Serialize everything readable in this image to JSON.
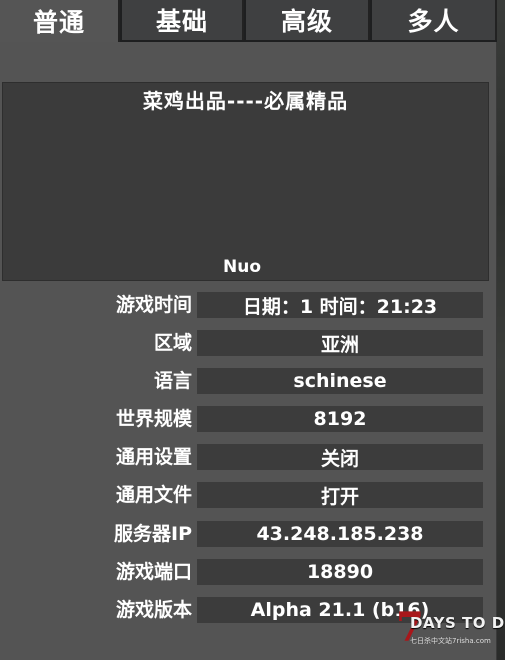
{
  "tabs": [
    {
      "label": "普通"
    },
    {
      "label": "基础"
    },
    {
      "label": "高级"
    },
    {
      "label": "多人"
    }
  ],
  "server": {
    "title": "菜鸡出品----必属精品",
    "owner": "Nuo"
  },
  "info_rows": [
    {
      "label": "游戏时间",
      "value": "日期：1 时间：21:23"
    },
    {
      "label": "区域",
      "value": "亚洲"
    },
    {
      "label": "语言",
      "value": "schinese"
    },
    {
      "label": "世界规模",
      "value": "8192"
    },
    {
      "label": "通用设置",
      "value": "关闭"
    },
    {
      "label": "通用文件",
      "value": "打开"
    },
    {
      "label": "服务器IP",
      "value": "43.248.185.238"
    },
    {
      "label": "游戏端口",
      "value": "18890"
    },
    {
      "label": "游戏版本",
      "value": "Alpha 21.1 (b16)"
    }
  ],
  "logo": {
    "mark": "7",
    "text": "DAYS TO DIE",
    "subtext": "七日杀中文站7risha.com"
  },
  "colors": {
    "panel": "#545454",
    "value_bg": "#3c3c3c",
    "tab_bg": "#3f4041",
    "logo_red": "#a8171b"
  }
}
